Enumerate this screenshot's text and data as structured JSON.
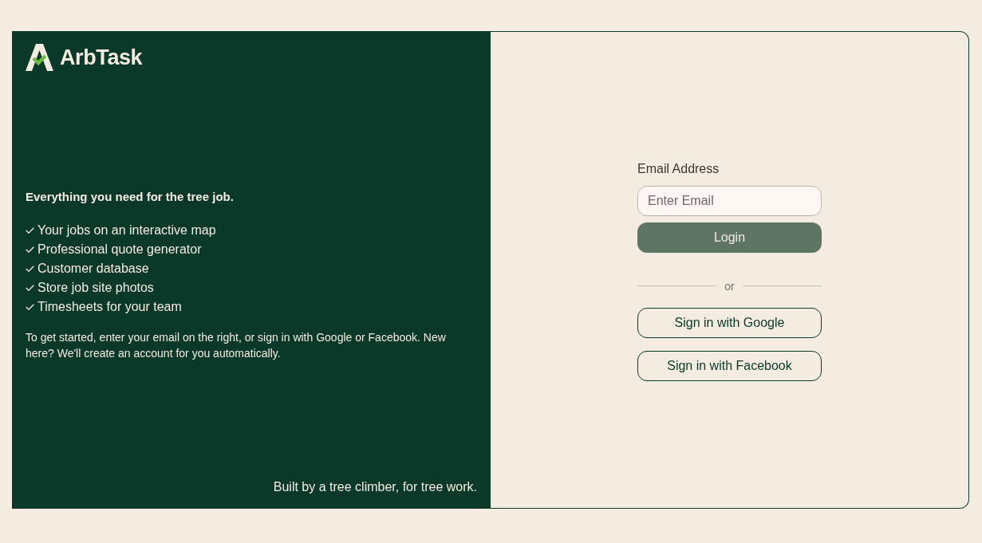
{
  "brand": {
    "name": "ArbTask"
  },
  "intro": {
    "heading": "Everything you need for the tree job.",
    "features": [
      "Your jobs on an interactive map",
      "Professional quote generator",
      "Customer database",
      "Store job site photos",
      "Timesheets for your team"
    ],
    "description": "To get started, enter your email on the right, or sign in with Google or Facebook. New here? We'll create an account for you automatically.",
    "footer": "Built by a tree climber, for tree work."
  },
  "login_form": {
    "email_field": {
      "label": "Email Address",
      "placeholder": "Enter Email"
    },
    "login_button": "Login",
    "divider": "or",
    "social_buttons": [
      {
        "label": "Sign in with Google"
      },
      {
        "label": "Sign in with Facebook"
      }
    ]
  }
}
